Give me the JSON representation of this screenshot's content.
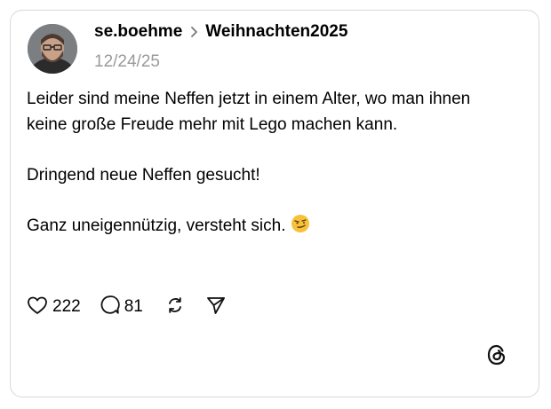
{
  "post": {
    "username": "se.boehme",
    "topic": "Weihnachten2025",
    "date": "12/24/25",
    "paragraphs": [
      "Leider sind meine Neffen jetzt in einem Alter, wo man ihnen keine große Freude mehr mit Lego machen kann.",
      "Dringend neue Neffen gesucht!",
      "Ganz uneigennützig, versteht sich."
    ],
    "emoji_icon": "smirking-face-emoji"
  },
  "actions": {
    "likes": "222",
    "replies": "81",
    "icons": [
      "heart-icon",
      "comment-icon",
      "repost-icon",
      "share-icon"
    ]
  },
  "brand": {
    "logo_icon": "threads-logo"
  },
  "colors": {
    "text": "#000000",
    "muted": "#9a9a9a",
    "border": "#d9d9d9",
    "emoji": "#f7c23a"
  }
}
